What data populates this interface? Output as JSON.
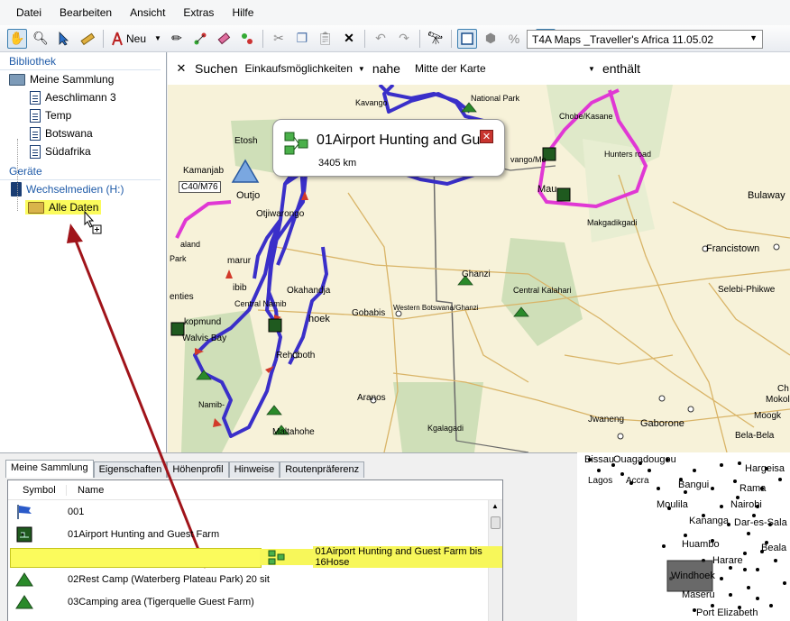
{
  "menu": [
    "Datei",
    "Bearbeiten",
    "Ansicht",
    "Extras",
    "Hilfe"
  ],
  "toolbar": {
    "new_label": "Neu",
    "map_product": "T4A Maps _Traveller's Africa 11.05.02"
  },
  "library": {
    "header": "Bibliothek",
    "root": "Meine Sammlung",
    "items": [
      "Aeschlimann 3",
      "Temp",
      "Botswana",
      "Südafrika"
    ]
  },
  "devices": {
    "header": "Geräte",
    "media": "Wechselmedien (H:)",
    "folder": "Alle Daten"
  },
  "search": {
    "close": "✕",
    "label": "Suchen",
    "category": "Einkaufsmöglichkeiten",
    "near_label": "nahe",
    "location": "Mitte der Karte",
    "contains_label": "enthält"
  },
  "map": {
    "popup_title": "01Airport Hunting and Gu",
    "popup_distance": "3405 km",
    "popup_close": "✕",
    "labels": [
      {
        "text": "National Park"
      },
      {
        "text": "Kavango"
      },
      {
        "text": "Chobe/Kasane"
      },
      {
        "text": "Hunters road"
      },
      {
        "text": "Etosh"
      },
      {
        "text": "Outjo"
      },
      {
        "text": "Kamanjab"
      },
      {
        "text": "C40/M76"
      },
      {
        "text": "Otjiwarongo"
      },
      {
        "text": "Makgadikgadi"
      },
      {
        "text": "Bulaway"
      },
      {
        "text": "Francistown"
      },
      {
        "text": "Ghanzi"
      },
      {
        "text": "Central Kalahari"
      },
      {
        "text": "Selebi-Phikwe"
      },
      {
        "text": "Okahandja"
      },
      {
        "text": "Central Namib"
      },
      {
        "text": "hoek"
      },
      {
        "text": "Gobabis"
      },
      {
        "text": "Western Botswana/Ghanzi"
      },
      {
        "text": "kopmund"
      },
      {
        "text": "Walvis Bay"
      },
      {
        "text": "Rehoboth"
      },
      {
        "text": "Aranos"
      },
      {
        "text": "Mokol"
      },
      {
        "text": "Moogk"
      },
      {
        "text": "Jwaneng"
      },
      {
        "text": "Gaborone"
      },
      {
        "text": "Kgalagadi"
      },
      {
        "text": "Maltahohe"
      },
      {
        "text": "Namib-"
      },
      {
        "text": "Bela-Bela"
      },
      {
        "text": "Mau"
      },
      {
        "text": "vango/Mo"
      },
      {
        "text": "aland"
      },
      {
        "text": "Park"
      },
      {
        "text": "marur"
      },
      {
        "text": "ibib"
      },
      {
        "text": "enties"
      },
      {
        "text": "Ch"
      }
    ]
  },
  "tabs": [
    "Meine Sammlung",
    "Eigenschaften",
    "Höhenprofil",
    "Hinweise",
    "Routenpräferenz"
  ],
  "list": {
    "columns": [
      "Symbol",
      "Name"
    ],
    "rows": [
      {
        "name": "001",
        "icon": "flag-icon"
      },
      {
        "name": "01Airport Hunting and Guest Farm",
        "icon": "lodge-icon"
      },
      {
        "name": "01Airport Hunting and Guest Farm bis 16Hose",
        "icon": "route-icon"
      },
      {
        "name": "02Rest Camp (Waterberg Plateau Park) 20 sit",
        "icon": "tent-icon"
      },
      {
        "name": "03Camping area (Tigerquelle Guest Farm)",
        "icon": "tent-icon"
      }
    ]
  },
  "minimap": {
    "labels": [
      "Bissau",
      "Ouagadougou",
      "Hargeisa",
      "Lagos",
      "Accra",
      "Bangui",
      "Rama",
      "Moulila",
      "Nairobi",
      "Kananga",
      "Dar-es-Sala",
      "Huambo",
      "Harare",
      "Beala",
      "Windhoek",
      "Maseru",
      "Port Elizabeth"
    ]
  }
}
